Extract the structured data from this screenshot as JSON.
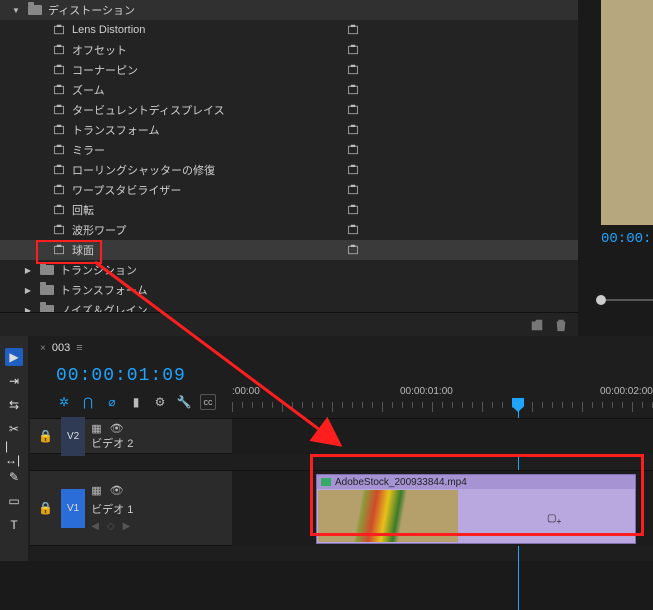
{
  "effects": {
    "category": "ディストーション",
    "items": [
      "Lens Distortion",
      "オフセット",
      "コーナーピン",
      "ズーム",
      "タービュレントディスプレイス",
      "トランスフォーム",
      "ミラー",
      "ローリングシャッターの修復",
      "ワープスタビライザー",
      "回転",
      "波形ワープ",
      "球面"
    ],
    "folders": [
      "トランジション",
      "トランスフォーム",
      "ノイズ＆グレイン"
    ]
  },
  "preview": {
    "timecode_partial": "00:00:"
  },
  "sequence": {
    "name": "003",
    "timecode": "00:00:01:09"
  },
  "ruler": {
    "labels": [
      ":00:00",
      "00:00:01:00",
      "00:00:02:00"
    ]
  },
  "tracks": {
    "v2": {
      "id": "V2",
      "name": "ビデオ 2"
    },
    "v1": {
      "id": "V1",
      "name": "ビデオ 1"
    }
  },
  "clip": {
    "filename": "AdobeStock_200933844.mp4"
  }
}
